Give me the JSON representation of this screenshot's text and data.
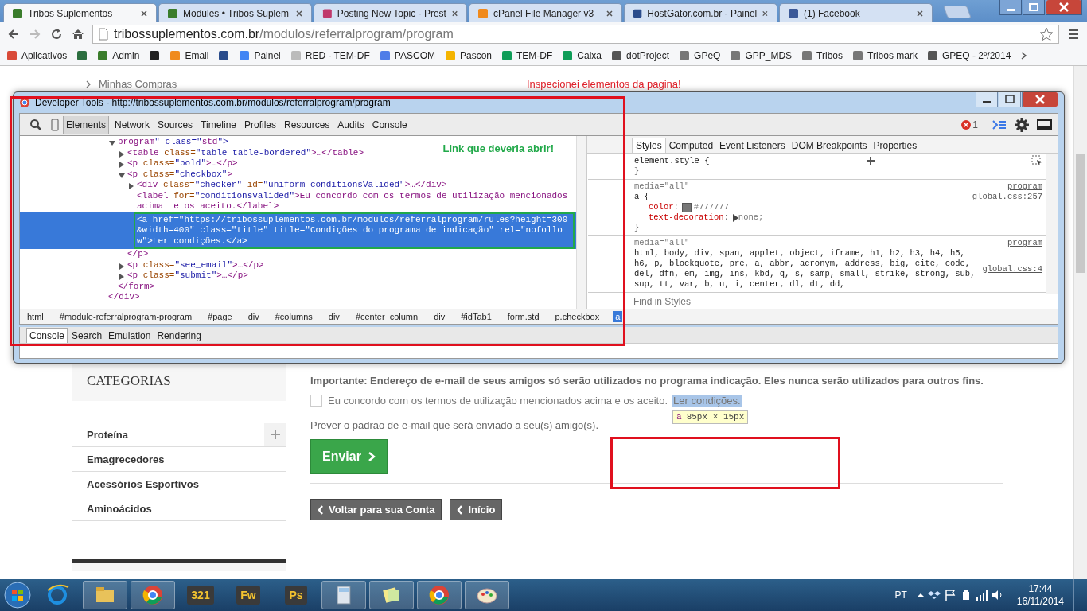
{
  "browser": {
    "tabs": [
      {
        "title": "Tribos Suplementos",
        "selected": true,
        "color": "#3a7d2c"
      },
      {
        "title": "Modules • Tribos Suplem",
        "selected": false,
        "color": "#3a7d2c"
      },
      {
        "title": "Posting New Topic - Prest",
        "selected": false,
        "color": "#c0396b"
      },
      {
        "title": "cPanel File Manager v3",
        "selected": false,
        "color": "#f08a1c"
      },
      {
        "title": "HostGator.com.br - Painel",
        "selected": false,
        "color": "#2a4c8c"
      },
      {
        "title": "(1) Facebook",
        "selected": false,
        "color": "#3b5998"
      }
    ],
    "address": {
      "host": "tribossuplementos.com.br",
      "path": "/modulos/referralprogram/program"
    },
    "bookmarks": [
      {
        "label": "Aplicativos",
        "color": "#d94a38"
      },
      {
        "color": "#2b6e3f"
      },
      {
        "label": "Admin",
        "color": "#3a7d2c"
      },
      {
        "color": "#222222"
      },
      {
        "label": "Email",
        "color": "#f08a1c"
      },
      {
        "color": "#2a4c8c"
      },
      {
        "label": "Painel",
        "color": "#4285f4"
      },
      {
        "label": "RED - TEM-DF",
        "color": "#bbbbbb"
      },
      {
        "label": "PASCOM",
        "color": "#4f7de8"
      },
      {
        "label": "Pascon",
        "color": "#f4b400"
      },
      {
        "label": "TEM-DF",
        "color": "#0f9d58"
      },
      {
        "label": "Caixa",
        "color": "#0f9d58"
      },
      {
        "label": "dotProject",
        "color": "#555555"
      },
      {
        "label": "GPeQ",
        "color": "#777777"
      },
      {
        "label": "GPP_MDS",
        "color": "#777777"
      },
      {
        "label": "Tribos",
        "color": "#777777"
      },
      {
        "label": "Tribos  mark",
        "color": "#777777"
      },
      {
        "label": "GPEQ - 2º/2014",
        "color": "#555555"
      }
    ]
  },
  "page": {
    "breadcrumb": "Minhas Compras",
    "annotation": "Inspecionei elementos da pagina!",
    "sidebar": {
      "heading": "CATEGORIAS",
      "items": [
        {
          "label": "Proteína",
          "expandable": true
        },
        {
          "label": "Emagrecedores",
          "expandable": false
        },
        {
          "label": "Acessórios Esportivos",
          "expandable": false
        },
        {
          "label": "Aminoácidos",
          "expandable": false
        }
      ]
    },
    "notice": "Importante: Endereço de e-mail de seus amigos só serão utilizados no programa indicação. Eles nunca serão utilizados para outros fins.",
    "agree": {
      "checked": false,
      "label": "Eu concordo com os termos de utilização mencionados acima e os aceito.",
      "link": "Ler condições.",
      "link_highlighted": true
    },
    "inspect_tooltip": {
      "tag": "a",
      "size": "85px × 15px"
    },
    "preview": "Prever o padrão de e-mail que será enviado a seu(s) amigo(s).",
    "submit": "Enviar",
    "nav": [
      {
        "label": "Voltar para sua Conta"
      },
      {
        "label": "Início"
      }
    ]
  },
  "devtools": {
    "title": "Developer Tools - http://tribossuplementos.com.br/modulos/referralprogram/program",
    "panels": [
      {
        "label": "Elements",
        "selected": true
      },
      {
        "label": "Network",
        "selected": false
      },
      {
        "label": "Sources",
        "selected": false
      },
      {
        "label": "Timeline",
        "selected": false
      },
      {
        "label": "Profiles",
        "selected": false
      },
      {
        "label": "Resources",
        "selected": false
      },
      {
        "label": "Audits",
        "selected": false
      },
      {
        "label": "Console",
        "selected": false
      }
    ],
    "errors": "1",
    "note": "Link que deveria abrir!",
    "dom": [
      {
        "close": "</div>",
        "children": [
          {
            "text": "program\" class=\"std\">",
            "expanded": true,
            "selected": false,
            "close": "</form>",
            "children": [
              {
                "text": "<table class=\"table table-bordered\">…</table>",
                "expanded": false,
                "selected": false
              },
              {
                "text": "<p class=\"bold\">…</p>",
                "expanded": false,
                "selected": false
              },
              {
                "text": "<p class=\"checkbox\">",
                "expanded": true,
                "selected": false,
                "close": "</p>",
                "children": [
                  {
                    "text": "<div class=\"checker\" id=\"uniform-conditionsValided\">…</div>",
                    "expanded": false,
                    "selected": false
                  },
                  {
                    "text": "<label for=\"conditionsValided\">Eu concordo com os termos de utilização mencionados acima  e os aceito.</label>",
                    "selected": false
                  },
                  {
                    "text": "<a href=\"https://tribossuplementos.com.br/modulos/referralprogram/rules?height=300&width=400\" class=\"title\" title=\"Condições do programa de indicação\" rel=\"nofollow\">Ler condições.</a>",
                    "selected": true
                  }
                ]
              },
              {
                "text": "<p class=\"see_email\">…</p>",
                "expanded": false,
                "selected": false
              },
              {
                "text": "<p class=\"submit\">…</p>",
                "expanded": false,
                "selected": false
              }
            ]
          }
        ]
      }
    ],
    "crumbs": [
      {
        "label": "html",
        "selected": false
      },
      {
        "label": "#module-referralprogram-program",
        "selected": false
      },
      {
        "label": "#page",
        "selected": false
      },
      {
        "label": "div",
        "selected": false
      },
      {
        "label": "#columns",
        "selected": false
      },
      {
        "label": "div",
        "selected": false
      },
      {
        "label": "#center_column",
        "selected": false
      },
      {
        "label": "div",
        "selected": false
      },
      {
        "label": "#idTab1",
        "selected": false
      },
      {
        "label": "form.std",
        "selected": false
      },
      {
        "label": "p.checkbox",
        "selected": false
      },
      {
        "label": "a",
        "selected": true
      }
    ],
    "side_tabs": [
      {
        "label": "Styles",
        "selected": true
      },
      {
        "label": "Computed",
        "selected": false
      },
      {
        "label": "Event Listeners",
        "selected": false
      },
      {
        "label": "DOM Breakpoints",
        "selected": false
      },
      {
        "label": "Properties",
        "selected": false
      }
    ],
    "rules": [
      {
        "selector": "element.style {",
        "end": "}"
      },
      {
        "media": "media=\"all\"",
        "source": "program",
        "file": "global.css:257",
        "selector": "a {",
        "props": [
          {
            "name": "color",
            "separator": ":",
            "value": "#777777",
            "kind": "color"
          },
          {
            "name": "text-decoration",
            "separator": ":",
            "value": "none;",
            "kind": "shorthand"
          }
        ],
        "end": "}"
      },
      {
        "media": "media=\"all\"",
        "source": "program",
        "file": "global.css:4",
        "selector": "html, body, div, span, applet, object, iframe, h1, h2, h3, h4, h5, h6, p, blockquote, pre, a, abbr, acronym, address, big, cite, code, del, dfn, em, img, ins, kbd, q, s, samp, small, strike, strong, sub, sup, tt, var, b, u, i, center, dl, dt, dd,"
      }
    ],
    "filter": {
      "placeholder": "Find in Styles"
    },
    "drawer_tabs": [
      {
        "label": "Console",
        "selected": true
      },
      {
        "label": "Search",
        "selected": false
      },
      {
        "label": "Emulation",
        "selected": false
      },
      {
        "label": "Rendering",
        "selected": false
      }
    ]
  },
  "taskbar": {
    "apps": [
      {
        "kind": "ie",
        "pinned": false
      },
      {
        "kind": "folder",
        "pinned": true
      },
      {
        "kind": "chrome",
        "pinned": true
      },
      {
        "kind": "text",
        "label": "321",
        "pinned": false
      },
      {
        "kind": "text",
        "label": "Fw",
        "pinned": false
      },
      {
        "kind": "text",
        "label": "Ps",
        "pinned": false
      },
      {
        "kind": "calc",
        "pinned": true
      },
      {
        "kind": "notes",
        "pinned": true
      },
      {
        "kind": "chrome",
        "pinned": true
      },
      {
        "kind": "paint",
        "pinned": true
      }
    ],
    "language": "PT",
    "time": "17:44",
    "date": "16/11/2014"
  }
}
